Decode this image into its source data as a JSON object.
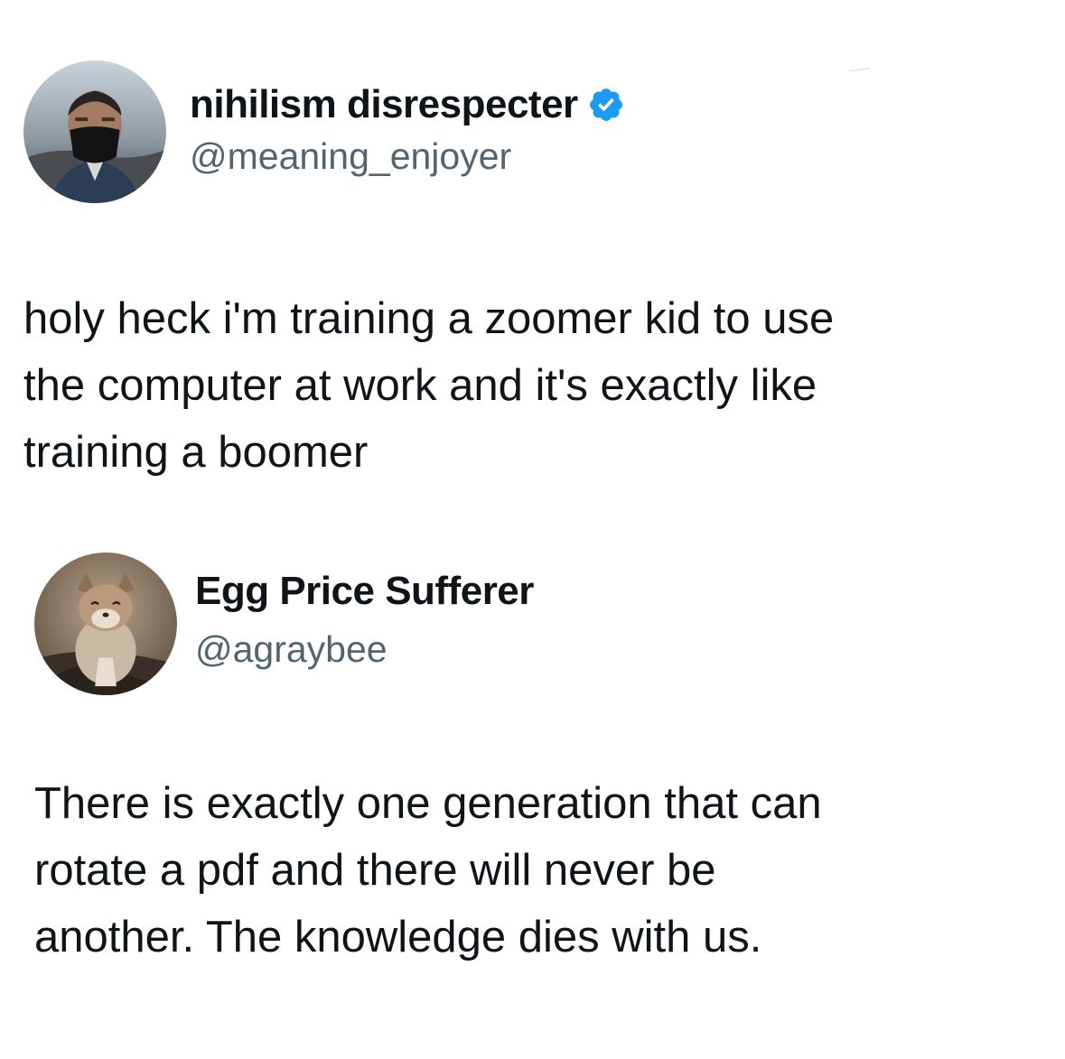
{
  "tweets": [
    {
      "display_name": "nihilism disrespecter",
      "handle": "@meaning_enjoyer",
      "verified": true,
      "avatar_icon": "masked-man-avatar",
      "text": "holy heck i'm training a zoomer kid to use\nthe computer at work and it's exactly like\ntraining a boomer"
    },
    {
      "display_name": "Egg Price Sufferer",
      "handle": "@agraybee",
      "verified": false,
      "avatar_icon": "fox-avatar",
      "text": "There is exactly one generation that can\nrotate a pdf and there will never be\nanother. The knowledge dies with us."
    }
  ],
  "colors": {
    "text": "#0f1419",
    "handle": "#536471",
    "verified_badge": "#1d9bf0",
    "background": "#ffffff"
  }
}
